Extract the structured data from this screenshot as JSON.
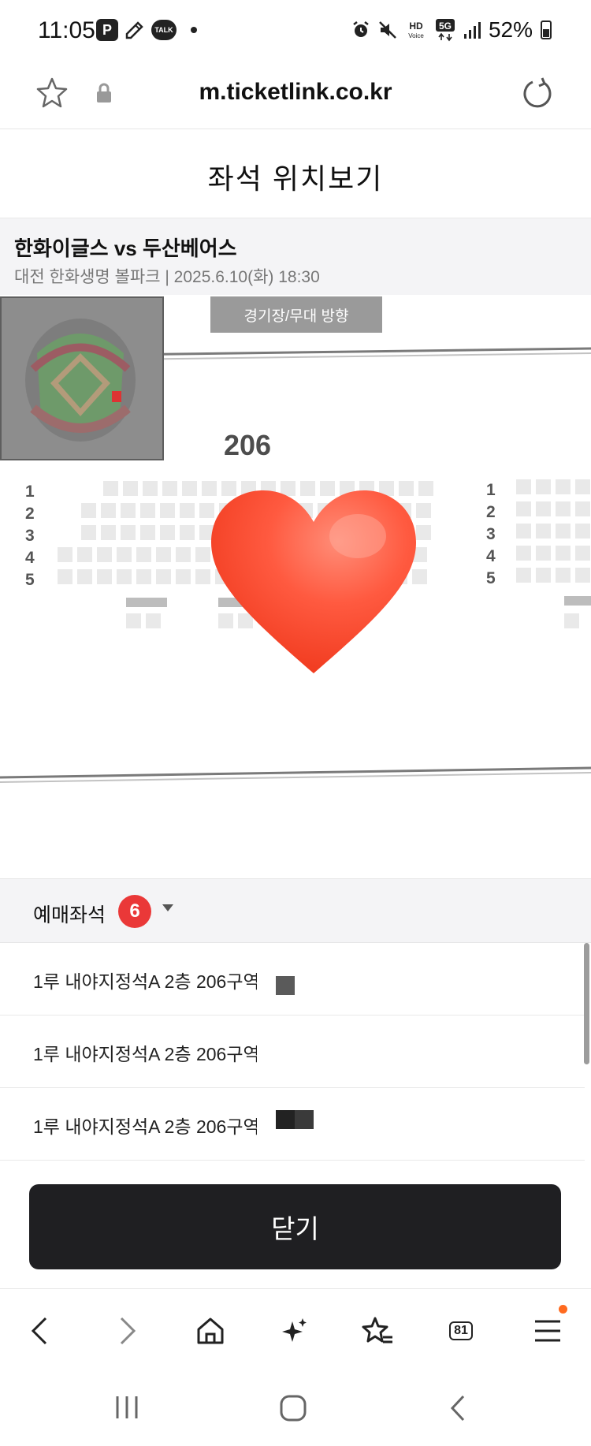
{
  "status_bar": {
    "time": "11:05",
    "left_icons": [
      "P",
      "TALK"
    ],
    "hd_label": "HD",
    "voice_label": "Voice",
    "network": "5G",
    "battery": "52%"
  },
  "browser": {
    "url": "m.ticketlink.co.kr",
    "tab_count": "81"
  },
  "page": {
    "title": "좌석 위치보기"
  },
  "game": {
    "title": "한화이글스 vs 두산베어스",
    "venue_datetime": "대전 한화생명 볼파크 | 2025.6.10(화) 18:30"
  },
  "seat_map": {
    "stage_direction_label": "경기장/무대 방향",
    "section_number": "206",
    "row_labels_left": [
      "1",
      "2",
      "3",
      "4",
      "5"
    ],
    "row_labels_right": [
      "1",
      "2",
      "3",
      "4",
      "5"
    ]
  },
  "booked": {
    "title": "예매좌석",
    "count": "6",
    "items": [
      "1루 내야지정석A 2층 206구역",
      "1루 내야지정석A 2층 206구역",
      "1루 내야지정석A 2층 206구역"
    ]
  },
  "actions": {
    "close_label": "닫기"
  },
  "colors": {
    "accent_red": "#ea3838",
    "button_dark": "#1f1f22",
    "heart": "#ff4a33",
    "notification_dot": "#ff6a1f"
  }
}
